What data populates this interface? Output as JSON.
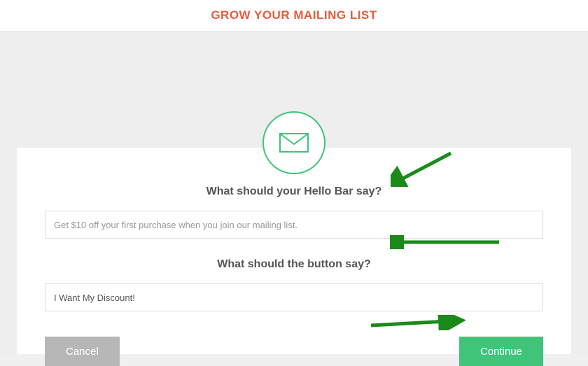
{
  "header": {
    "title": "GROW YOUR MAILING LIST"
  },
  "icon": {
    "name": "envelope"
  },
  "form": {
    "question1": "What should your Hello Bar say?",
    "input1_placeholder": "Get $10 off your first purchase when you join our mailing list.",
    "input1_value": "",
    "question2": "What should the button say?",
    "input2_value": "I Want My Discount!"
  },
  "buttons": {
    "cancel": "Cancel",
    "continue": "Continue"
  },
  "colors": {
    "accent_green": "#3fc47a",
    "title_orange": "#e85a3a",
    "cancel_gray": "#b7b7b7"
  }
}
